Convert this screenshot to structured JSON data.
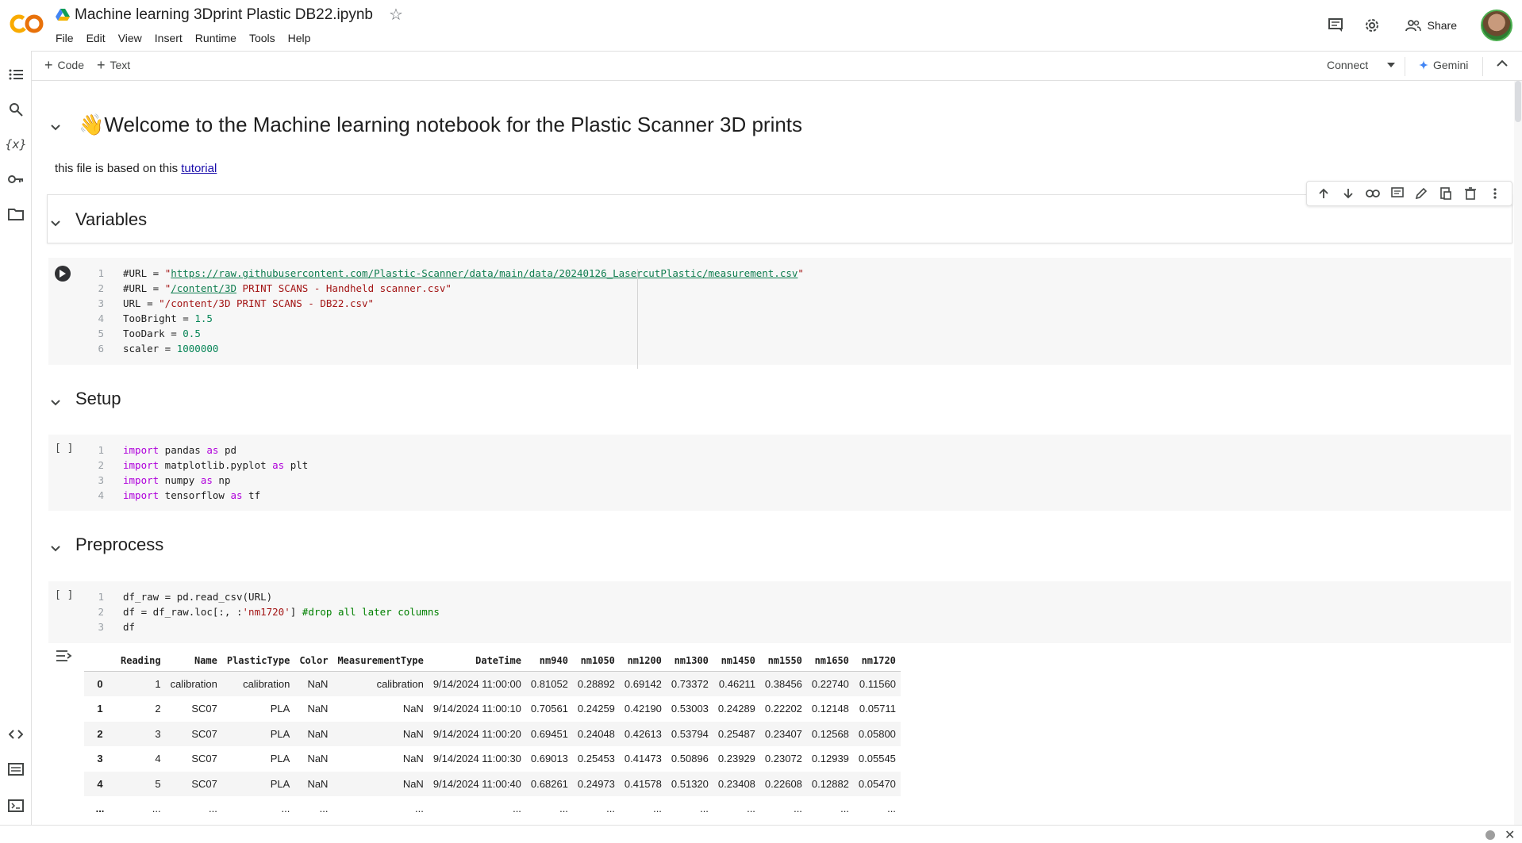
{
  "app": {
    "logo": "CO",
    "title": "Machine learning 3Dprint Plastic DB22.ipynb",
    "menu": [
      "File",
      "Edit",
      "View",
      "Insert",
      "Runtime",
      "Tools",
      "Help"
    ],
    "share_label": "Share"
  },
  "toolbar": {
    "code_label": "Code",
    "text_label": "Text",
    "connect_label": "Connect",
    "gemini_label": "Gemini"
  },
  "notebook": {
    "welcome_emoji": "👋",
    "welcome_title": "Welcome to the Machine learning notebook for the Plastic Scanner 3D prints",
    "intro_text": "this file is based on this ",
    "intro_link": "tutorial",
    "sections": {
      "variables": "Variables",
      "setup": "Setup",
      "preprocess": "Preprocess"
    },
    "run_empty": "[ ]",
    "variables_code": [
      {
        "n": "1",
        "parts": [
          [
            "pl",
            "#URL = "
          ],
          [
            "str",
            "\""
          ],
          [
            "url",
            "https://raw.githubusercontent.com/Plastic-Scanner/data/main/data/20240126_LasercutPlastic/measurement.csv"
          ],
          [
            "str",
            "\""
          ]
        ]
      },
      {
        "n": "2",
        "parts": [
          [
            "pl",
            "#URL = "
          ],
          [
            "str",
            "\""
          ],
          [
            "url",
            "/content/3D"
          ],
          [
            "str",
            " PRINT SCANS - Handheld scanner.csv\""
          ]
        ]
      },
      {
        "n": "3",
        "parts": [
          [
            "pl",
            "URL = "
          ],
          [
            "str",
            "\"/content/3D PRINT SCANS - DB22.csv\""
          ]
        ]
      },
      {
        "n": "4",
        "parts": [
          [
            "pl",
            "TooBright = "
          ],
          [
            "num",
            "1.5"
          ]
        ]
      },
      {
        "n": "5",
        "parts": [
          [
            "pl",
            "TooDark = "
          ],
          [
            "num",
            "0.5"
          ]
        ]
      },
      {
        "n": "6",
        "parts": [
          [
            "pl",
            "scaler = "
          ],
          [
            "num",
            "1000000"
          ]
        ]
      }
    ],
    "setup_code": [
      {
        "n": "1",
        "parts": [
          [
            "kw",
            "import"
          ],
          [
            "pl",
            " pandas "
          ],
          [
            "kw",
            "as"
          ],
          [
            "pl",
            " pd"
          ]
        ]
      },
      {
        "n": "2",
        "parts": [
          [
            "kw",
            "import"
          ],
          [
            "pl",
            " matplotlib.pyplot "
          ],
          [
            "kw",
            "as"
          ],
          [
            "pl",
            " plt"
          ]
        ]
      },
      {
        "n": "3",
        "parts": [
          [
            "kw",
            "import"
          ],
          [
            "pl",
            " numpy "
          ],
          [
            "kw",
            "as"
          ],
          [
            "pl",
            " np"
          ]
        ]
      },
      {
        "n": "4",
        "parts": [
          [
            "kw",
            "import"
          ],
          [
            "pl",
            " tensorflow "
          ],
          [
            "kw",
            "as"
          ],
          [
            "pl",
            " tf"
          ]
        ]
      }
    ],
    "preprocess_code": [
      {
        "n": "1",
        "parts": [
          [
            "pl",
            "df_raw = pd.read_csv(URL)"
          ]
        ]
      },
      {
        "n": "2",
        "parts": [
          [
            "pl",
            "df = df_raw.loc[:, :"
          ],
          [
            "str",
            "'nm1720'"
          ],
          [
            "pl",
            "] "
          ],
          [
            "cmt",
            "#drop all later columns"
          ]
        ]
      },
      {
        "n": "3",
        "parts": [
          [
            "pl",
            "df"
          ]
        ]
      }
    ],
    "table": {
      "columns": [
        "",
        "Reading",
        "Name",
        "PlasticType",
        "Color",
        "MeasurementType",
        "DateTime",
        "nm940",
        "nm1050",
        "nm1200",
        "nm1300",
        "nm1450",
        "nm1550",
        "nm1650",
        "nm1720"
      ],
      "rows": [
        [
          "0",
          "1",
          "calibration",
          "calibration",
          "NaN",
          "calibration",
          "9/14/2024 11:00:00",
          "0.81052",
          "0.28892",
          "0.69142",
          "0.73372",
          "0.46211",
          "0.38456",
          "0.22740",
          "0.11560"
        ],
        [
          "1",
          "2",
          "SC07",
          "PLA",
          "NaN",
          "NaN",
          "9/14/2024 11:00:10",
          "0.70561",
          "0.24259",
          "0.42190",
          "0.53003",
          "0.24289",
          "0.22202",
          "0.12148",
          "0.05711"
        ],
        [
          "2",
          "3",
          "SC07",
          "PLA",
          "NaN",
          "NaN",
          "9/14/2024 11:00:20",
          "0.69451",
          "0.24048",
          "0.42613",
          "0.53794",
          "0.25487",
          "0.23407",
          "0.12568",
          "0.05800"
        ],
        [
          "3",
          "4",
          "SC07",
          "PLA",
          "NaN",
          "NaN",
          "9/14/2024 11:00:30",
          "0.69013",
          "0.25453",
          "0.41473",
          "0.50896",
          "0.23929",
          "0.23072",
          "0.12939",
          "0.05545"
        ],
        [
          "4",
          "5",
          "SC07",
          "PLA",
          "NaN",
          "NaN",
          "9/14/2024 11:00:40",
          "0.68261",
          "0.24973",
          "0.41578",
          "0.51320",
          "0.23408",
          "0.22608",
          "0.12882",
          "0.05470"
        ],
        [
          "...",
          "...",
          "...",
          "...",
          "...",
          "...",
          "...",
          "...",
          "...",
          "...",
          "...",
          "...",
          "...",
          "...",
          "..."
        ]
      ]
    }
  },
  "colors": {
    "logo_orange": "#F9AB00",
    "keyword": "#af00db",
    "string": "#a31515",
    "number": "#098658",
    "comment": "#008000",
    "link": "#1a0dab",
    "gemini": "#4285f4"
  }
}
